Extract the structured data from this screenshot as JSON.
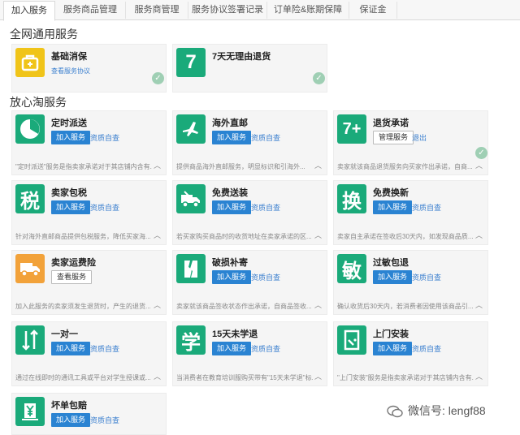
{
  "tabs": [
    "加入服务",
    "服务商品管理",
    "服务商管理",
    "服务协议签署记录",
    "订单险&账期保障",
    "保证金"
  ],
  "sections": {
    "general": "全网通用服务",
    "assured": "放心淘服务"
  },
  "general_cards": [
    {
      "name": "基础消保",
      "link": "查看服务协议",
      "icon": "bag-icon"
    },
    {
      "name": "7天无理由退货",
      "icon": "seven-icon",
      "tile_text": "7"
    }
  ],
  "cards": [
    {
      "name": "定时派送",
      "btn": "加入服务",
      "sec": "资质自查",
      "desc": "\"定时派送\"服务是指卖家承诺对于其店铺内含有...",
      "icon": "clock-icon"
    },
    {
      "name": "海外直邮",
      "btn": "加入服务",
      "sec": "资质自查",
      "desc": "提供商品海外直邮服务，明显标识和引海外...",
      "icon": "plane-icon"
    },
    {
      "name": "退货承诺",
      "btn": "管理服务",
      "sec": "退出",
      "desc": "卖家就该商品退货服务向买家作出承诺，自商...",
      "icon": "seven-plus-icon",
      "tile_text": "7+"
    },
    {
      "name": "卖家包税",
      "btn": "加入服务",
      "sec": "资质自查",
      "desc": "针对海外直邮商品提供包税服务，降低买家海...",
      "icon": "tax-icon",
      "tile_text": "税"
    },
    {
      "name": "免费送装",
      "btn": "加入服务",
      "sec": "资质自查",
      "desc": "若买家购买商品时的收货地址在卖家承诺的区...",
      "icon": "truck-wrench-icon"
    },
    {
      "name": "免费换新",
      "btn": "加入服务",
      "sec": "资质自查",
      "desc": "卖家自主承诺在签收后30天内，如发现商品质...",
      "icon": "exchange-icon",
      "tile_text": "换"
    },
    {
      "name": "卖家运费险",
      "btn": "查看服务",
      "sec": "",
      "desc": "加入此服务的卖家须发生退货时，产生的退货...",
      "icon": "truck-icon"
    },
    {
      "name": "破损补寄",
      "btn": "加入服务",
      "sec": "资质自查",
      "desc": "卖家就该商品签收状态作出承诺，自商品签收...",
      "icon": "broken-icon"
    },
    {
      "name": "过敏包退",
      "btn": "加入服务",
      "sec": "资质自查",
      "desc": "确认收货后30天内，若消费者因使用该商品引...",
      "icon": "allergy-icon",
      "tile_text": "敏"
    },
    {
      "name": "一对一",
      "btn": "加入服务",
      "sec": "资质自查",
      "desc": "通过在线即时的通讯工具或平台对学生授课或...",
      "icon": "one-on-one-icon"
    },
    {
      "name": "15天未学退",
      "btn": "加入服务",
      "sec": "资质自查",
      "desc": "当消费者在教育培训服购买带有\"15天未学退\"标...",
      "icon": "study-icon",
      "tile_text": "学"
    },
    {
      "name": "上门安装",
      "btn": "加入服务",
      "sec": "资质自查",
      "desc": "\"上门安装\"服务是指卖家承诺对于其店铺内含有...",
      "icon": "door-icon"
    },
    {
      "name": "坏单包赔",
      "btn": "加入服务",
      "sec": "资质自查",
      "desc": "",
      "icon": "yen-icon"
    }
  ],
  "watermark": "微信号: lengf88"
}
